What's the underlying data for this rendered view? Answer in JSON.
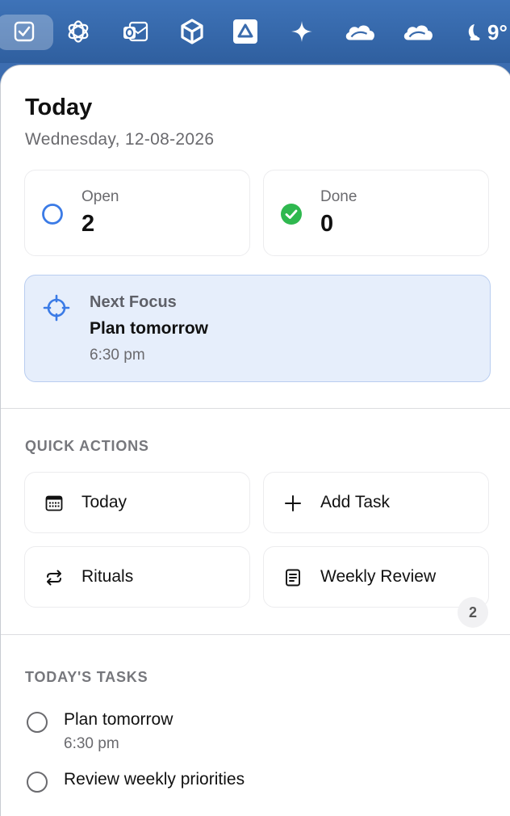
{
  "menubar": {
    "icons": [
      "checkbox-app-icon",
      "chatgpt-icon",
      "outlook-icon",
      "unity-icon",
      "drive-icon",
      "sparkle-icon",
      "cloud-icon",
      "cloud-icon"
    ],
    "weather": {
      "icon": "moon-cloud-icon",
      "temperature": "9°"
    }
  },
  "header": {
    "title": "Today",
    "date": "Wednesday, 12-08-2026"
  },
  "stats": {
    "open": {
      "label": "Open",
      "value": "2",
      "icon": "open-circle-icon",
      "color": "#3b7be6"
    },
    "done": {
      "label": "Done",
      "value": "0",
      "icon": "done-check-icon",
      "color": "#2fb84f"
    }
  },
  "next_focus": {
    "label": "Next Focus",
    "title": "Plan tomorrow",
    "time": "6:30 pm",
    "icon": "target-icon",
    "accent": "#3b7be6"
  },
  "quick_actions": {
    "heading": "QUICK ACTIONS",
    "items": [
      {
        "label": "Today",
        "icon": "calendar-icon"
      },
      {
        "label": "Add Task",
        "icon": "plus-icon"
      },
      {
        "label": "Rituals",
        "icon": "repeat-icon"
      },
      {
        "label": "Weekly Review",
        "icon": "document-icon"
      }
    ]
  },
  "tasks": {
    "heading": "TODAY'S TASKS",
    "count": "2",
    "items": [
      {
        "title": "Plan tomorrow",
        "time": "6:30 pm"
      },
      {
        "title": "Review weekly priorities"
      }
    ]
  }
}
